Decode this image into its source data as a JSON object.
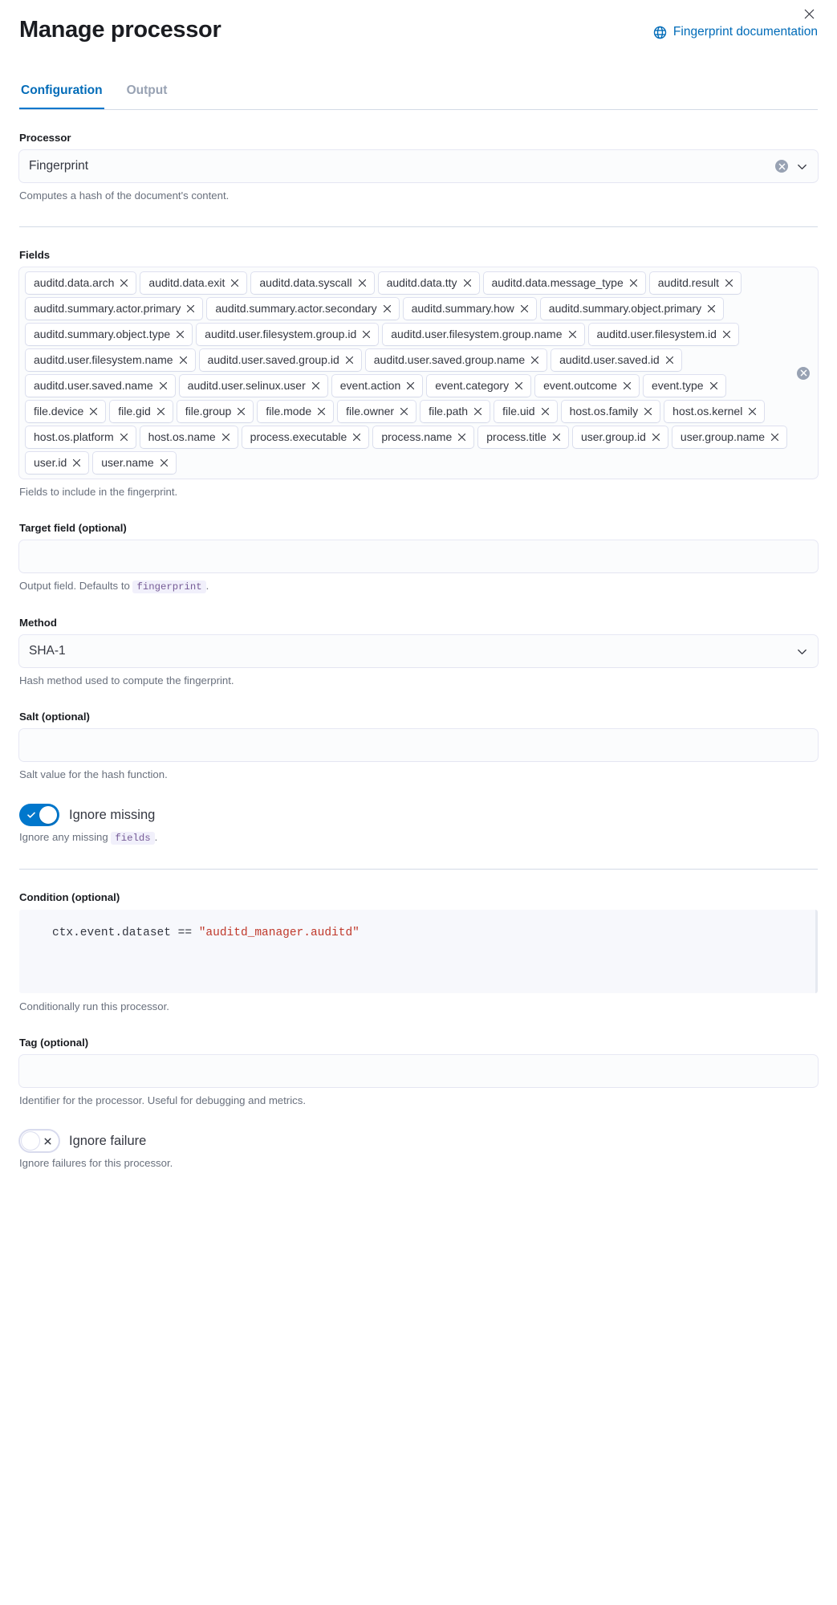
{
  "header": {
    "title": "Manage processor",
    "doc_link_label": "Fingerprint documentation",
    "doc_link_icon": "documentation-icon",
    "close_icon": "close-icon"
  },
  "tabs": [
    {
      "label": "Configuration",
      "active": true
    },
    {
      "label": "Output",
      "active": false
    }
  ],
  "processor": {
    "label": "Processor",
    "value": "Fingerprint",
    "help": "Computes a hash of the document's content.",
    "clear_icon": "clear-circle-icon",
    "chevron_icon": "chevron-down-icon"
  },
  "fields": {
    "label": "Fields",
    "help": "Fields to include in the fingerprint.",
    "clear_icon": "clear-circle-icon",
    "values": [
      "auditd.data.arch",
      "auditd.data.exit",
      "auditd.data.syscall",
      "auditd.data.tty",
      "auditd.data.message_type",
      "auditd.result",
      "auditd.summary.actor.primary",
      "auditd.summary.actor.secondary",
      "auditd.summary.how",
      "auditd.summary.object.primary",
      "auditd.summary.object.type",
      "auditd.user.filesystem.group.id",
      "auditd.user.filesystem.group.name",
      "auditd.user.filesystem.id",
      "auditd.user.filesystem.name",
      "auditd.user.saved.group.id",
      "auditd.user.saved.group.name",
      "auditd.user.saved.id",
      "auditd.user.saved.name",
      "auditd.user.selinux.user",
      "event.action",
      "event.category",
      "event.outcome",
      "event.type",
      "file.device",
      "file.gid",
      "file.group",
      "file.mode",
      "file.owner",
      "file.path",
      "file.uid",
      "host.os.family",
      "host.os.kernel",
      "host.os.platform",
      "host.os.name",
      "process.executable",
      "process.name",
      "process.title",
      "user.group.id",
      "user.group.name",
      "user.id",
      "user.name"
    ]
  },
  "target_field": {
    "label": "Target field (optional)",
    "value": "",
    "placeholder": "",
    "help_prefix": "Output field. Defaults to",
    "help_code": "fingerprint",
    "help_suffix": "."
  },
  "method": {
    "label": "Method",
    "value": "SHA-1",
    "help": "Hash method used to compute the fingerprint.",
    "chevron_icon": "chevron-down-icon"
  },
  "salt": {
    "label": "Salt (optional)",
    "value": "",
    "placeholder": "",
    "help": "Salt value for the hash function."
  },
  "ignore_missing": {
    "label": "Ignore missing",
    "on": true,
    "help_prefix": "Ignore any missing",
    "help_code": "fields",
    "help_suffix": ".",
    "icon": "check-icon"
  },
  "condition": {
    "label": "Condition (optional)",
    "code_prefix": "ctx.event.dataset == ",
    "code_string": "\"auditd_manager.auditd\"",
    "help": "Conditionally run this processor."
  },
  "tag": {
    "label": "Tag (optional)",
    "value": "",
    "placeholder": "",
    "help": "Identifier for the processor. Useful for debugging and metrics."
  },
  "ignore_failure": {
    "label": "Ignore failure",
    "on": false,
    "help": "Ignore failures for this processor.",
    "icon": "cross-icon"
  },
  "colors": {
    "accent": "#006bb8",
    "tab_underline": "#0077cc",
    "switch_on": "#0077cc",
    "code_string": "#c0392b",
    "inline_code": "#765b96",
    "muted_text": "#69707d"
  }
}
